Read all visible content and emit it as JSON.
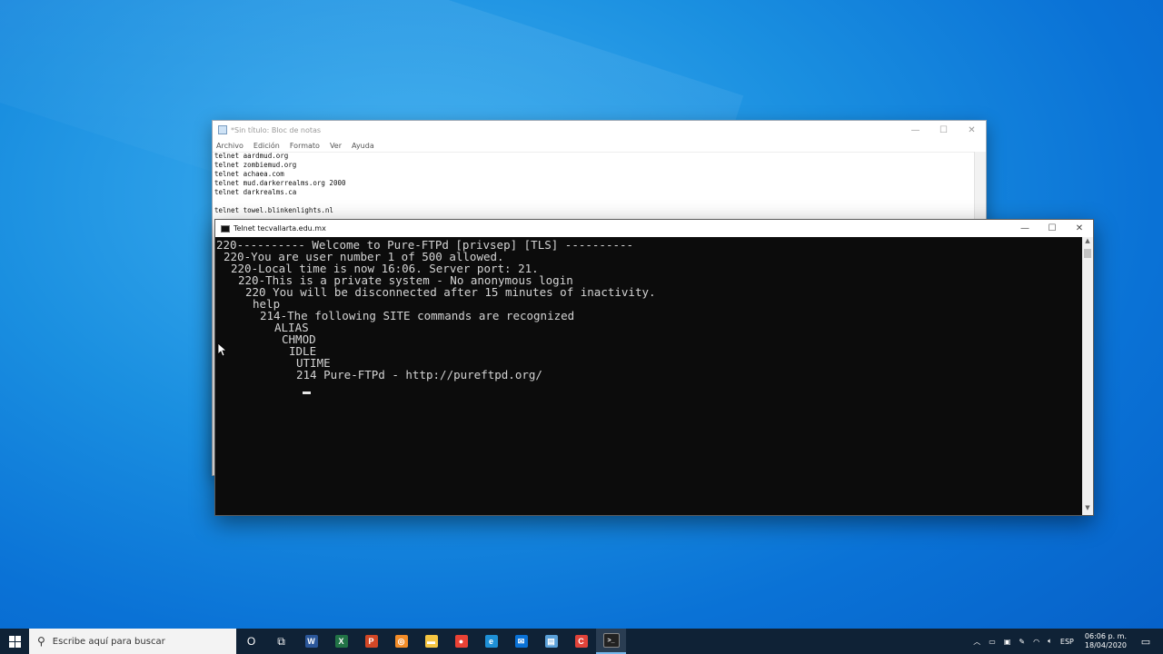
{
  "notepad": {
    "title": "*Sin título: Bloc de notas",
    "menu": [
      "Archivo",
      "Edición",
      "Formato",
      "Ver",
      "Ayuda"
    ],
    "lines": [
      "telnet aardmud.org",
      "telnet zombiemud.org",
      "telnet achaea.com",
      "telnet mud.darkerrealms.org 2000",
      "telnet darkrealms.ca",
      "",
      "telnet towel.blinkenlights.nl"
    ]
  },
  "console": {
    "title": "Telnet tecvallarta.edu.mx",
    "lines": [
      "220---------- Welcome to Pure-FTPd [privsep] [TLS] ----------",
      "220-You are user number 1 of 500 allowed.",
      "220-Local time is now 16:06. Server port: 21.",
      "220-This is a private system - No anonymous login",
      "220 You will be disconnected after 15 minutes of inactivity.",
      "help",
      "214-The following SITE commands are recognized",
      "ALIAS",
      "CHMOD",
      "IDLE",
      "UTIME",
      "214 Pure-FTPd - http://pureftpd.org/"
    ]
  },
  "taskbar": {
    "search_placeholder": "Escribe aquí para buscar",
    "apps": [
      {
        "icon": "cortana-icon",
        "label": "O",
        "color": "#ffffff"
      },
      {
        "icon": "task-view-icon",
        "label": "⧉",
        "color": "#ffffff"
      },
      {
        "icon": "word-icon",
        "label": "W",
        "color": "#2b579a"
      },
      {
        "icon": "excel-icon",
        "label": "X",
        "color": "#217346"
      },
      {
        "icon": "powerpoint-icon",
        "label": "P",
        "color": "#d24726"
      },
      {
        "icon": "app-orange-icon",
        "label": "◎",
        "color": "#f28c28"
      },
      {
        "icon": "file-explorer-icon",
        "label": "▬",
        "color": "#f4c542"
      },
      {
        "icon": "chrome-icon",
        "label": "●",
        "color": "#e94235"
      },
      {
        "icon": "edge-icon",
        "label": "e",
        "color": "#1e90d6"
      },
      {
        "icon": "mail-icon",
        "label": "✉",
        "color": "#0a72d6"
      },
      {
        "icon": "notepad-icon",
        "label": "▤",
        "color": "#5aa0d8"
      },
      {
        "icon": "camtasia-icon",
        "label": "C",
        "color": "#e0433a"
      },
      {
        "icon": "cmd-icon",
        "label": ">_",
        "color": "#222222"
      }
    ],
    "language": "ESP",
    "time": "06:06 p. m.",
    "date": "18/04/2020"
  }
}
